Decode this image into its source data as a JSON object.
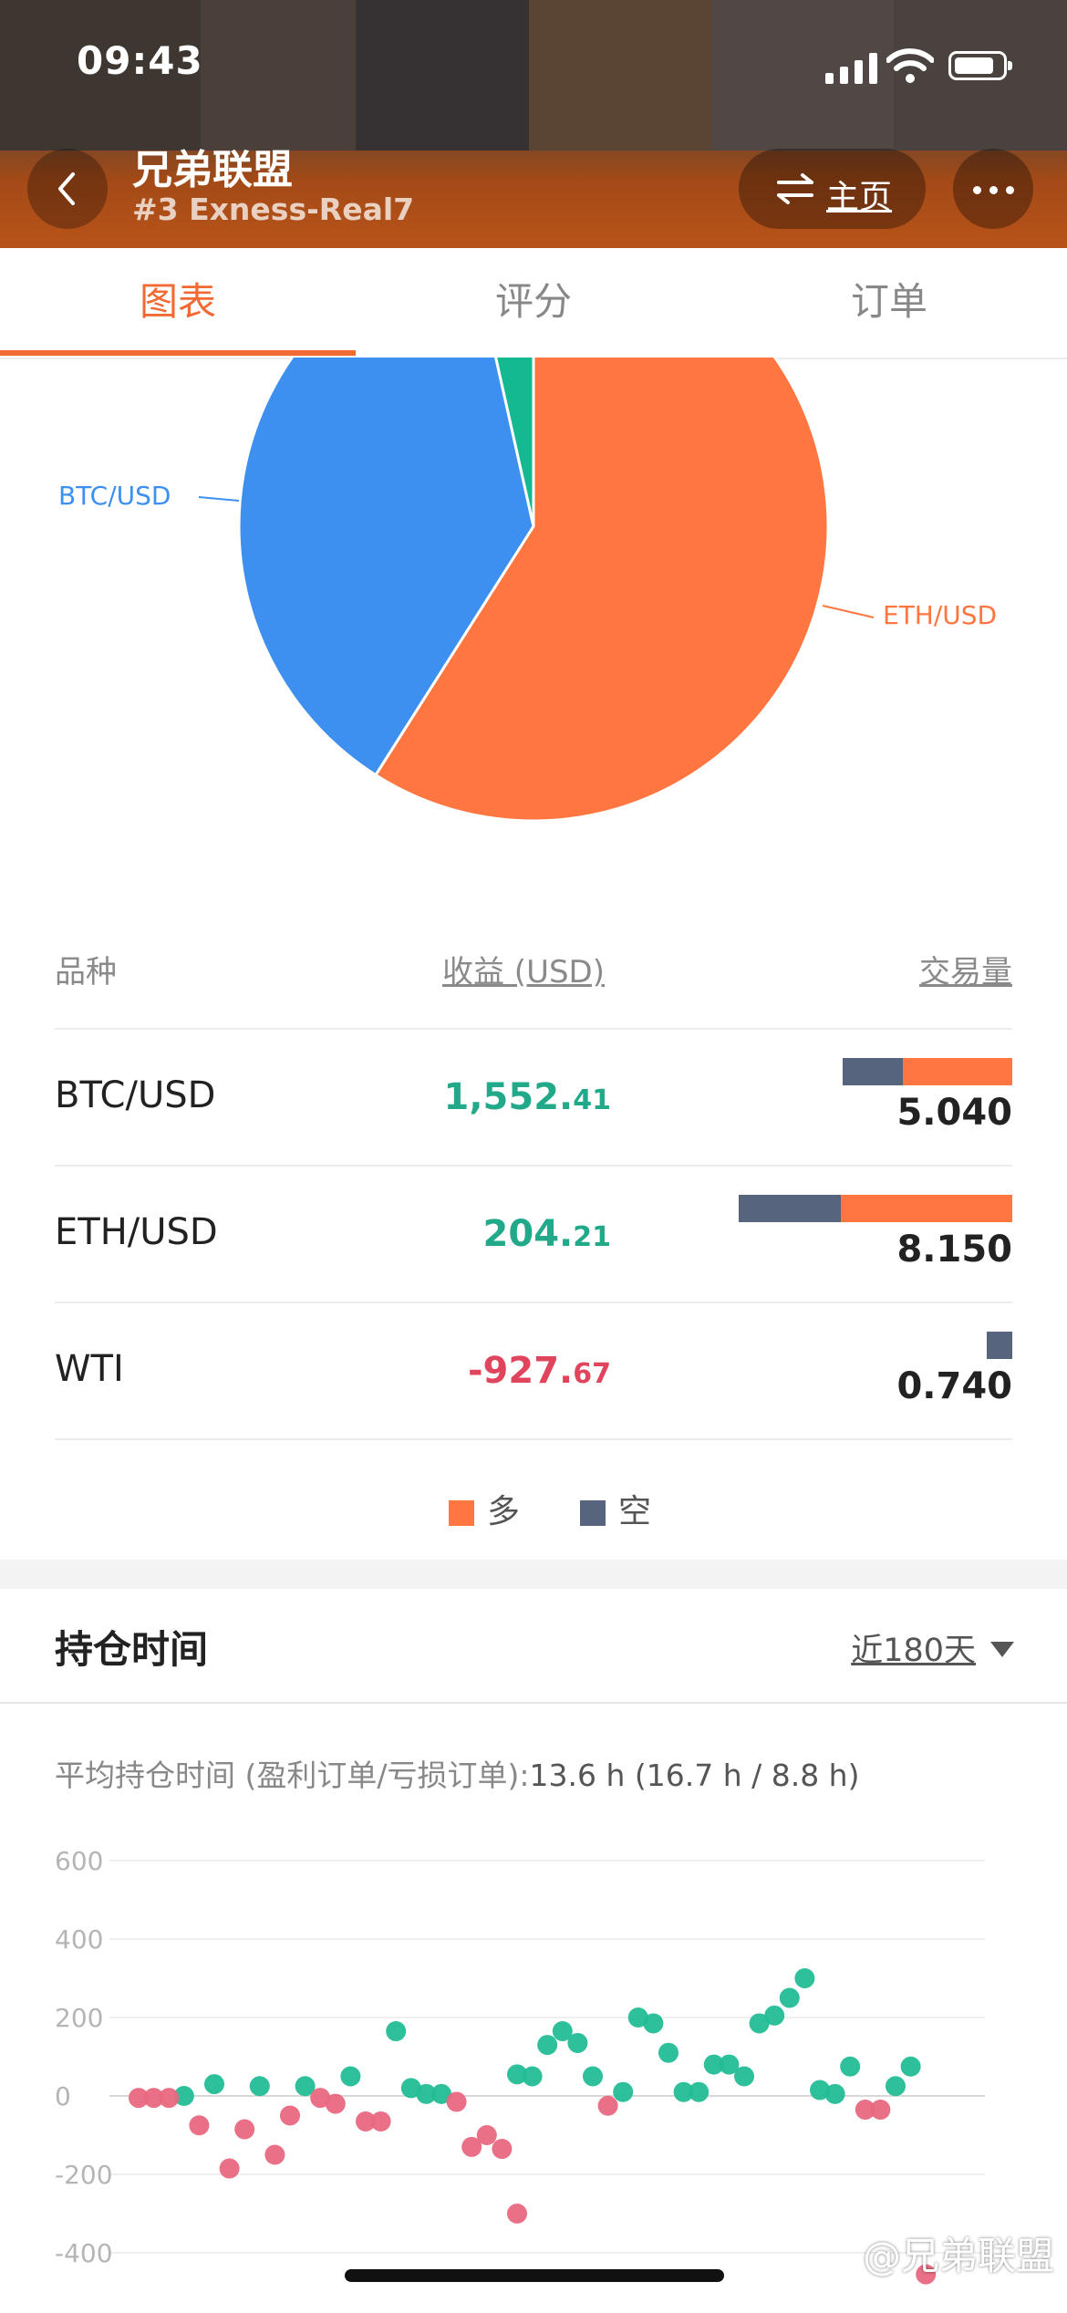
{
  "status_bar": {
    "time": "09:43"
  },
  "header": {
    "title": "兄弟联盟",
    "subtitle": "#3 Exness-Real7",
    "home_label": "主页"
  },
  "tabs": [
    {
      "label": "图表",
      "active": true
    },
    {
      "label": "评分",
      "active": false
    },
    {
      "label": "订单",
      "active": false
    }
  ],
  "pie": {
    "slices": [
      {
        "label": "ETH/USD",
        "value": 59,
        "color": "#ff7640"
      },
      {
        "label": "BTC/USD",
        "value": 37.5,
        "color": "#3d90f0"
      },
      {
        "label": "WTI",
        "value": 3.5,
        "color": "#14b891"
      }
    ]
  },
  "table": {
    "col_symbol": "品种",
    "col_profit": "收益 (USD)",
    "col_volume": "交易量",
    "rows": [
      {
        "symbol": "BTC/USD",
        "profit_int": "1,552.",
        "profit_dec": "41",
        "sign": "pos",
        "volume": "5.040",
        "short": 2.04,
        "long": 3.0
      },
      {
        "symbol": "ETH/USD",
        "profit_int": "204.",
        "profit_dec": "21",
        "sign": "pos",
        "volume": "8.150",
        "short": 3.4,
        "long": 4.75
      },
      {
        "symbol": "WTI",
        "profit_int": "-927.",
        "profit_dec": "67",
        "sign": "neg",
        "volume": "0.740",
        "short": 0.74,
        "long": 0
      }
    ]
  },
  "legend": {
    "long": "多",
    "short": "空",
    "long_color": "#ff7640",
    "short_color": "#56647d"
  },
  "holding": {
    "title": "持仓时间",
    "range": "近180天",
    "avg_label": "平均持仓时间 (盈利订单/亏损订单):",
    "avg_value": "13.6 h (16.7 h / 8.8 h)"
  },
  "chart_data": {
    "type": "scatter",
    "y_ticks": [
      "600",
      "400",
      "200",
      "0",
      "-200",
      "-400"
    ],
    "ylim": [
      -400,
      600
    ],
    "series": [
      {
        "color": "#22bd95",
        "values": [
          [
            4,
            0
          ],
          [
            6,
            30
          ],
          [
            9,
            25
          ],
          [
            12,
            25
          ],
          [
            15,
            50
          ],
          [
            18,
            165
          ],
          [
            19,
            20
          ],
          [
            20,
            5
          ],
          [
            21,
            5
          ],
          [
            26,
            55
          ],
          [
            27,
            50
          ],
          [
            28,
            130
          ],
          [
            29,
            165
          ],
          [
            30,
            135
          ],
          [
            31,
            50
          ],
          [
            33,
            10
          ],
          [
            34,
            200
          ],
          [
            35,
            185
          ],
          [
            36,
            110
          ],
          [
            37,
            10
          ],
          [
            38,
            10
          ],
          [
            39,
            80
          ],
          [
            40,
            80
          ],
          [
            41,
            50
          ],
          [
            42,
            185
          ],
          [
            43,
            205
          ],
          [
            44,
            250
          ],
          [
            45,
            300
          ],
          [
            46,
            15
          ],
          [
            47,
            5
          ],
          [
            48,
            75
          ],
          [
            51,
            25
          ],
          [
            52,
            75
          ]
        ]
      },
      {
        "color": "#e8687f",
        "values": [
          [
            1,
            -5
          ],
          [
            2,
            -5
          ],
          [
            3,
            -5
          ],
          [
            5,
            -75
          ],
          [
            7,
            -185
          ],
          [
            8,
            -85
          ],
          [
            10,
            -150
          ],
          [
            11,
            -50
          ],
          [
            13,
            -5
          ],
          [
            14,
            -20
          ],
          [
            16,
            -65
          ],
          [
            17,
            -65
          ],
          [
            22,
            -15
          ],
          [
            23,
            -130
          ],
          [
            24,
            -100
          ],
          [
            25,
            -135
          ],
          [
            26,
            -300
          ],
          [
            32,
            -25
          ],
          [
            49,
            -35
          ],
          [
            50,
            -35
          ],
          [
            53,
            -455
          ]
        ]
      }
    ]
  },
  "watermark": "@兄弟联盟"
}
